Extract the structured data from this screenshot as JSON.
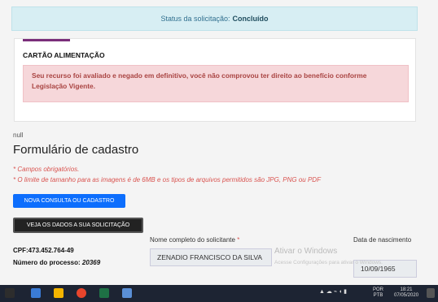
{
  "status": {
    "label": "Status da solicitação:",
    "value": "Concluído"
  },
  "card": {
    "title": "CARTÃO ALIMENTAÇÃO",
    "alert": "Seu recurso foi avaliado e negado em definitivo, você não comprovou ter direito ao benefício conforme Legislação Vigente."
  },
  "null_text": "null",
  "form": {
    "title": "Formulário de cadastro",
    "required_note": "* Campos obrigatórios.",
    "size_note": "* O limite de tamanho para as imagens é de 6MB e os tipos de arquivos permitidos são JPG, PNG ou PDF",
    "btn_new": "NOVA CONSULTA OU CADASTRO",
    "btn_view": "VEJA OS DADOS A SUA SOLICITAÇÃO",
    "cpf": "CPF:473.452.764-49",
    "process_label": "Número do processo:",
    "process_value": "20369",
    "name_label": "Nome completo do solicitante",
    "name_value": "ZENADIO FRANCISCO DA SILVA",
    "date_label": "Data de nascimento",
    "date_value": "10/09/1965",
    "asterisk": "*"
  },
  "watermark": {
    "line1": "Ativar o Windows",
    "line2": "Acesse Configurações para ativar o Windows."
  },
  "taskbar": {
    "lang_top": "POR",
    "lang_bottom": "PTB",
    "time": "18:21",
    "date": "07/05/2020"
  }
}
